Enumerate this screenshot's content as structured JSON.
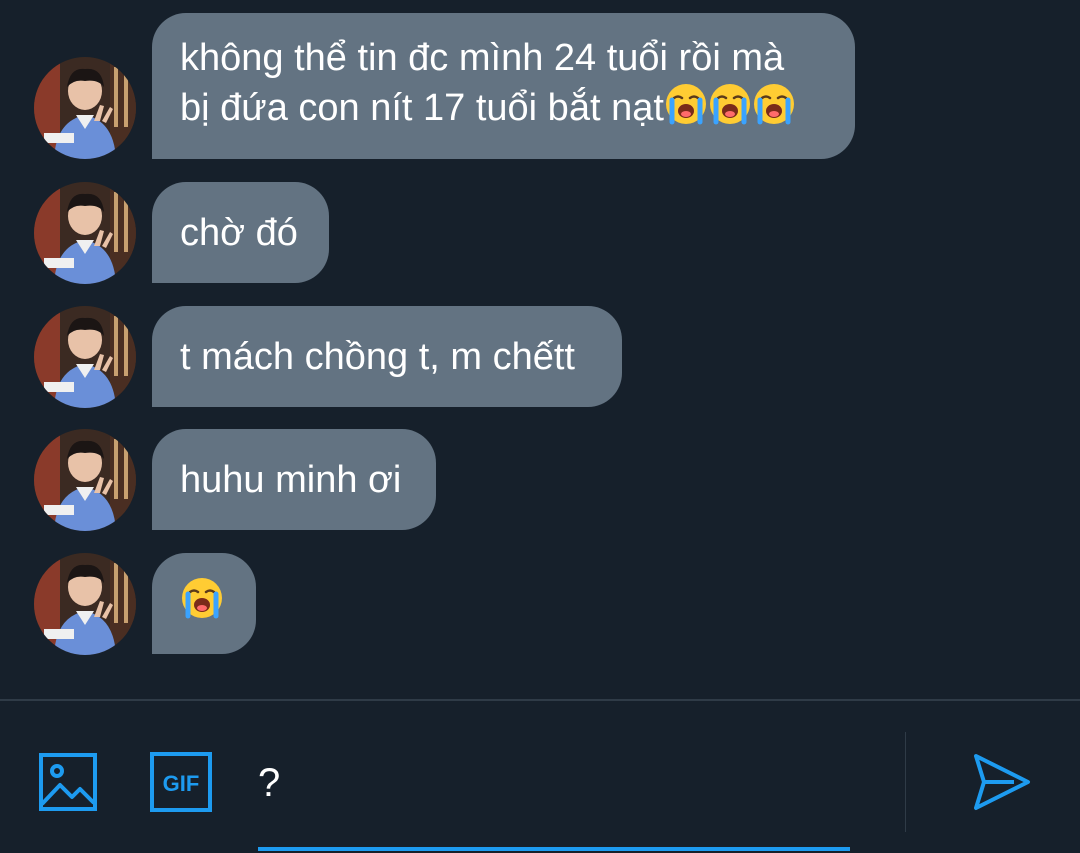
{
  "conversation": {
    "messages": [
      {
        "text": "không thể tin đc mình 24 tuổi rồi mà\nbị đứa con nít 17 tuổi bắt nạt",
        "emojis": [
          "loudly-crying-face",
          "loudly-crying-face",
          "loudly-crying-face"
        ]
      },
      {
        "text": "chờ đó",
        "emojis": []
      },
      {
        "text": "t mách chồng t, m chếtt",
        "emojis": []
      },
      {
        "text": "huhu minh ơi",
        "emojis": []
      },
      {
        "text": "",
        "emojis": [
          "loudly-crying-face"
        ]
      }
    ]
  },
  "composer": {
    "input_value": "?",
    "image_icon": "image-icon",
    "gif_label": "GIF",
    "send_icon": "send-icon"
  },
  "colors": {
    "background": "#16202b",
    "bubble": "#637382",
    "accent": "#1d9bf0",
    "divider": "#2f3b47"
  }
}
